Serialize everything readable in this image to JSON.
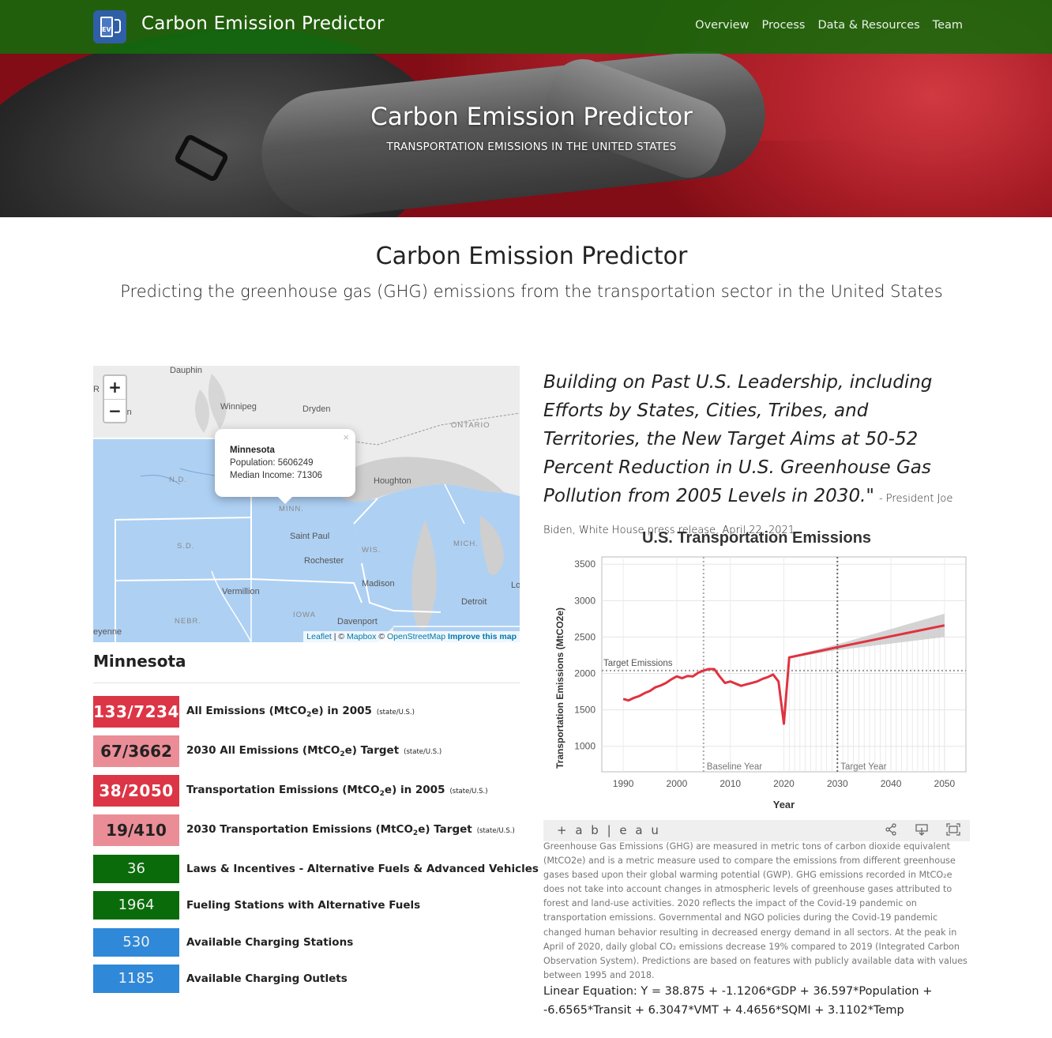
{
  "navbar": {
    "brand_icon": "ev-fuel-pump-icon",
    "brand_icon_text": "EV",
    "brand_title": "Carbon Emission Predictor",
    "links": [
      "Overview",
      "Process",
      "Data & Resources",
      "Team"
    ]
  },
  "hero": {
    "title": "Carbon Emission Predictor",
    "subtitle": "TRANSPORTATION EMISSIONS IN THE UNITED STATES"
  },
  "main": {
    "title": "Carbon Emission Predictor",
    "subtitle": "Predicting the greenhouse gas (GHG) emissions from the transportation sector in the United States"
  },
  "map": {
    "zoom_in": "+",
    "zoom_out": "−",
    "labels": {
      "dauphin": "Dauphin",
      "winnipeg": "Winnipeg",
      "dryden": "Dryden",
      "ontario": "ONTARIO",
      "nd": "N.D.",
      "houghton": "Houghton",
      "minn": "MINN.",
      "saint_paul": "Saint Paul",
      "sd": "S.D.",
      "wis": "WIS.",
      "mich": "MICH.",
      "rochester": "Rochester",
      "madison": "Madison",
      "vermillion": "Vermillion",
      "iowa": "IOWA",
      "detroit": "Detroit",
      "nebr": "NEBR.",
      "davenport": "Davenport",
      "cheyenne": "eyenne",
      "lo": "Lo",
      "r_edge": "R",
      "rn_edge": "rn"
    },
    "popup": {
      "title": "Minnesota",
      "population": "Population: 5606249",
      "income": "Median Income: 71306",
      "close": "×"
    },
    "attribution": {
      "leaflet": "Leaflet",
      "sep1": " | © ",
      "mapbox": "Mapbox",
      "sep2": " © ",
      "osm": "OpenStreetMap",
      "improve": "Improve this map"
    }
  },
  "state": {
    "name": "Minnesota",
    "stats": [
      {
        "value": "133/7234",
        "label": "All Emissions (MtCO",
        "sub": "2",
        "label2": "e) in 2005",
        "suffix": "(state/U.S.)",
        "color": "#dc3545"
      },
      {
        "value": "67/3662",
        "label": "2030 All Emissions (MtCO",
        "sub": "2",
        "label2": "e) Target",
        "suffix": "(state/U.S.)",
        "color": "#ea8d97"
      },
      {
        "value": "38/2050",
        "label": "Transportation Emissions (MtCO",
        "sub": "2",
        "label2": "e) in 2005",
        "suffix": "(state/U.S.)",
        "color": "#dc3545"
      },
      {
        "value": "19/410",
        "label": "2030 Transportation Emissions (MtCO",
        "sub": "2",
        "label2": "e) Target",
        "suffix": "(state/U.S.)",
        "color": "#ea8d97"
      },
      {
        "value": "36",
        "label": "Laws & Incentives - Alternative Fuels & Advanced Vehicles",
        "color": "#0a6b0a"
      },
      {
        "value": "1964",
        "label": "Fueling Stations with Alternative Fuels",
        "color": "#0a6b0a"
      },
      {
        "value": "530",
        "label": "Available Charging Stations",
        "color": "#2f88d8"
      },
      {
        "value": "1185",
        "label": "Available Charging Outlets",
        "color": "#2f88d8"
      }
    ]
  },
  "quote": {
    "text": "Building on Past U.S. Leadership, including Efforts by States, Cities, Tribes, and Territories, the New Target Aims at 50-52 Percent Reduction in U.S. Greenhouse Gas Pollution from 2005 Levels in 2030.\"",
    "attribution": "- President Joe Biden, White House press release, April 22, 2021."
  },
  "chart_data": {
    "type": "line",
    "title": "U.S. Transportation Emissions",
    "xlabel": "Year",
    "ylabel": "Transportation Emissions (MtCO2e)",
    "xlim": [
      1986,
      2054
    ],
    "ylim": [
      650,
      3600
    ],
    "x_ticks": [
      1990,
      2000,
      2010,
      2020,
      2030,
      2040,
      2050
    ],
    "y_ticks": [
      1000,
      1500,
      2000,
      2500,
      3000,
      3500
    ],
    "grid": true,
    "series": [
      {
        "name": "",
        "color": "#e0323f",
        "x": [
          1990,
          1991,
          1992,
          1993,
          1994,
          1995,
          1996,
          1997,
          1998,
          1999,
          2000,
          2001,
          2002,
          2003,
          2004,
          2005,
          2006,
          2007,
          2008,
          2009,
          2010,
          2011,
          2012,
          2013,
          2014,
          2015,
          2016,
          2017,
          2018,
          2019,
          2020,
          2021,
          2030,
          2050
        ],
        "y": [
          1650,
          1630,
          1665,
          1690,
          1730,
          1760,
          1810,
          1835,
          1870,
          1920,
          1960,
          1935,
          1965,
          1960,
          2010,
          2040,
          2060,
          2060,
          1960,
          1870,
          1890,
          1860,
          1830,
          1850,
          1870,
          1890,
          1925,
          1950,
          1985,
          1890,
          1310,
          2220,
          2360,
          2660
        ]
      }
    ],
    "forecast_band": {
      "x": [
        2021,
        2030,
        2050
      ],
      "lower": [
        2210,
        2320,
        2500
      ],
      "upper": [
        2230,
        2400,
        2820
      ]
    },
    "reference_lines": [
      {
        "axis": "y",
        "value": 2040,
        "label": "Target Emissions"
      },
      {
        "axis": "x",
        "value": 2005,
        "label": "Baseline Year"
      },
      {
        "axis": "x",
        "value": 2030,
        "label": "Target Year"
      }
    ]
  },
  "tableau": {
    "logo": "+ a b | e a u",
    "share_icon": "share-icon",
    "download_icon": "download-icon",
    "fullscreen_icon": "fullscreen-icon"
  },
  "description": "Greenhouse Gas Emissions (GHG) are measured in metric tons of carbon dioxide equivalent (MtCO2e) and is a metric measure used to compare the emissions from different greenhouse gases based upon their global warming potential (GWP). GHG emissions recorded in MtCO₂e does not take into account changes in atmospheric levels of greenhouse gases attributed to forest and land-use activities. 2020 reflects the impact of the Covid-19 pandemic on transportation emissions. Governmental and NGO policies during the Covid-19 pandemic changed human behavior resulting in decreased energy demand in all sectors. At the peak in April of 2020, daily global CO₂ emissions decrease 19% compared to 2019 (Integrated Carbon Observation System). Predictions are based on features with publicly available data with values between 1995 and 2018.",
  "equation": "Linear Equation: Y = 38.875 + -1.1206*GDP + 36.597*Population + -6.6565*Transit + 6.3047*VMT + 4.4656*SQMI + 3.1102*Temp"
}
